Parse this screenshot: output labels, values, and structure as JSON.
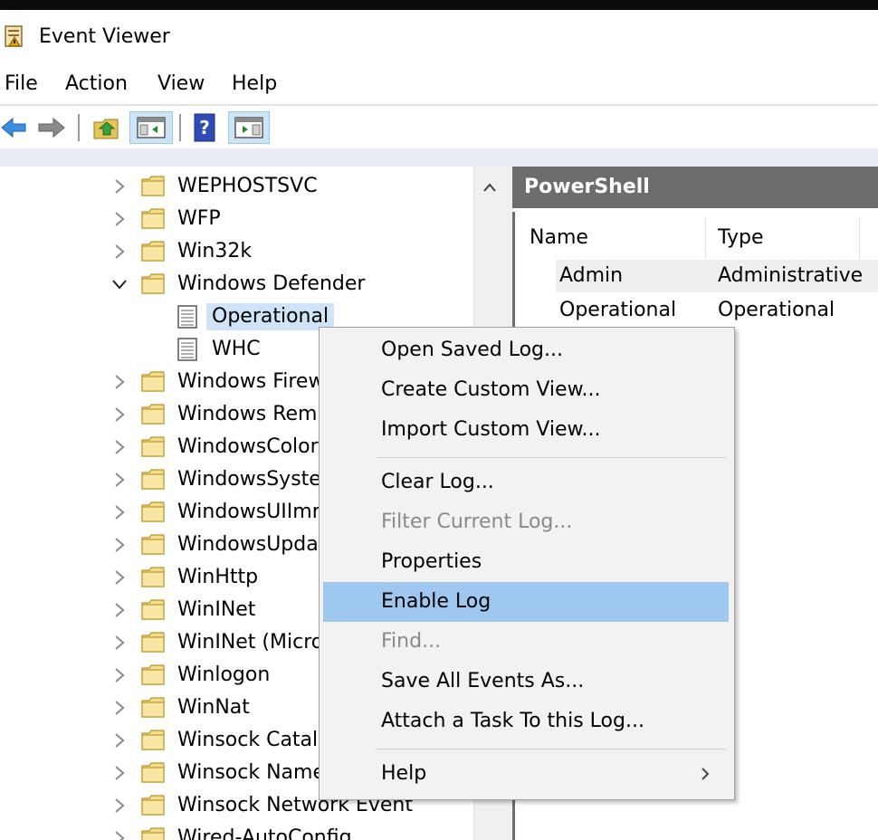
{
  "window": {
    "title": "Event Viewer"
  },
  "menubar": [
    "File",
    "Action",
    "View",
    "Help"
  ],
  "toolbar": {
    "buttons": [
      "back-icon",
      "forward-icon",
      "up-folder-icon",
      "show-hide-tree-icon",
      "help-icon",
      "show-hide-action-pane-icon"
    ]
  },
  "tree": {
    "items": [
      {
        "label": "WEPHOSTSVC",
        "expanded": false
      },
      {
        "label": "WFP",
        "expanded": false
      },
      {
        "label": "Win32k",
        "expanded": false
      },
      {
        "label": "Windows Defender",
        "expanded": true
      },
      {
        "label": "Operational",
        "log": true,
        "selected": true
      },
      {
        "label": "WHC",
        "log": true
      },
      {
        "label": "Windows Firew",
        "expanded": false
      },
      {
        "label": "Windows Rem",
        "expanded": false
      },
      {
        "label": "WindowsColor",
        "expanded": false
      },
      {
        "label": "WindowsSyste",
        "expanded": false
      },
      {
        "label": "WindowsUIImr",
        "expanded": false
      },
      {
        "label": "WindowsUpda",
        "expanded": false
      },
      {
        "label": "WinHttp",
        "expanded": false
      },
      {
        "label": "WinINet",
        "expanded": false
      },
      {
        "label": "WinINet (Micro",
        "expanded": false
      },
      {
        "label": "Winlogon",
        "expanded": false
      },
      {
        "label": "WinNat",
        "expanded": false
      },
      {
        "label": "Winsock Catalo",
        "expanded": false
      },
      {
        "label": "Winsock Name",
        "expanded": false
      },
      {
        "label": "Winsock Network Event",
        "expanded": false
      },
      {
        "label": "Wired-AutoConfig",
        "expanded": false
      }
    ]
  },
  "pane": {
    "title": "PowerShell",
    "columns": [
      "Name",
      "Type"
    ],
    "rows": [
      {
        "name": "Admin",
        "type": "Administrative"
      },
      {
        "name": "Operational",
        "type": "Operational"
      }
    ]
  },
  "context_menu": {
    "groups": [
      [
        {
          "label": "Open Saved Log..."
        },
        {
          "label": "Create Custom View..."
        },
        {
          "label": "Import Custom View..."
        }
      ],
      [
        {
          "label": "Clear Log..."
        },
        {
          "label": "Filter Current Log...",
          "disabled": true
        },
        {
          "label": "Properties"
        },
        {
          "label": "Enable Log",
          "highlighted": true
        },
        {
          "label": "Find...",
          "disabled": true
        },
        {
          "label": "Save All Events As..."
        },
        {
          "label": "Attach a Task To this Log..."
        }
      ],
      [
        {
          "label": "Help",
          "submenu": true
        }
      ]
    ]
  },
  "colors": {
    "selection": "#cfe4f8",
    "menu_highlight": "#9fc8f0",
    "pane_header": "#6d6d6d",
    "disabled_text": "#8a8a8a"
  }
}
